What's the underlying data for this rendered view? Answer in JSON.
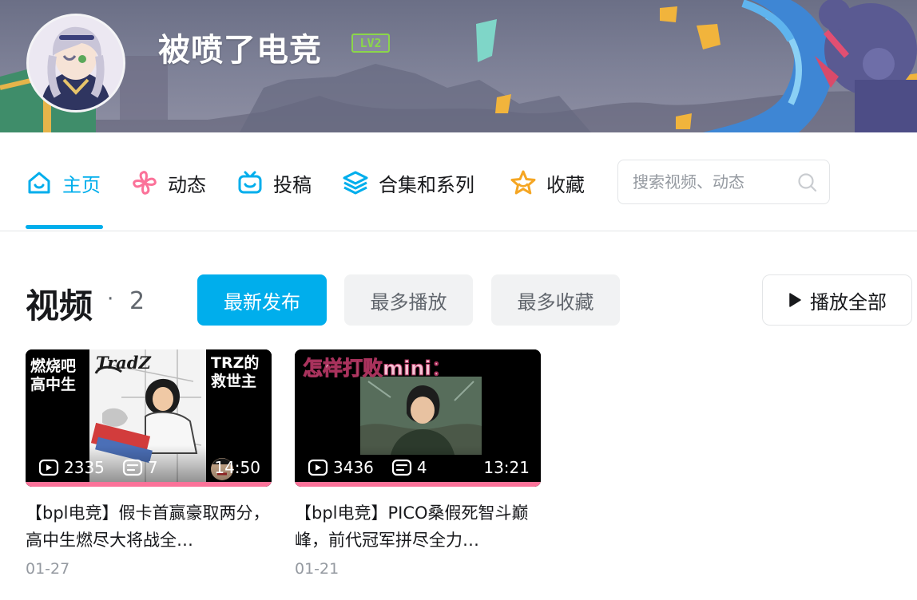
{
  "profile": {
    "name": "被喷了电竞",
    "level": "LV2"
  },
  "nav": {
    "items": [
      {
        "label": "主页",
        "icon": "home-icon",
        "active": true
      },
      {
        "label": "动态",
        "icon": "pinwheel-icon",
        "active": false
      },
      {
        "label": "投稿",
        "icon": "tv-icon",
        "active": false
      },
      {
        "label": "合集和系列",
        "icon": "layers-icon",
        "active": false
      },
      {
        "label": "收藏",
        "icon": "star-icon",
        "active": false
      }
    ],
    "search_placeholder": "搜索视频、动态"
  },
  "videos_section": {
    "title": "视频",
    "separator": "·",
    "count": "2",
    "sort_options": [
      "最新发布",
      "最多播放",
      "最多收藏"
    ],
    "selected_sort": "最新发布",
    "play_all_label": "播放全部"
  },
  "videos": [
    {
      "title": "【bpl电竞】假卡首赢豪取两分，高中生燃尽大将战全…",
      "date": "01-27",
      "views": "2335",
      "danmaku": "7",
      "duration": "14:50",
      "progress": 1.0,
      "thumb_text": {
        "left": "燃烧吧\n高中生",
        "center": "TradZ",
        "right": "TRZ的\n救世主"
      }
    },
    {
      "title": "【bpl电竞】PICO桑假死智斗巅峰，前代冠军拼尽全力…",
      "date": "01-21",
      "views": "3436",
      "danmaku": "4",
      "duration": "13:21",
      "progress": 1.0,
      "thumb_text": {
        "top": "怎样打败mini："
      }
    }
  ],
  "colors": {
    "accent": "#00aeec",
    "progress": "#fb7299",
    "level_badge": "#8bd64a",
    "pinwheel": "#fb7299",
    "star": "#f5a623"
  }
}
